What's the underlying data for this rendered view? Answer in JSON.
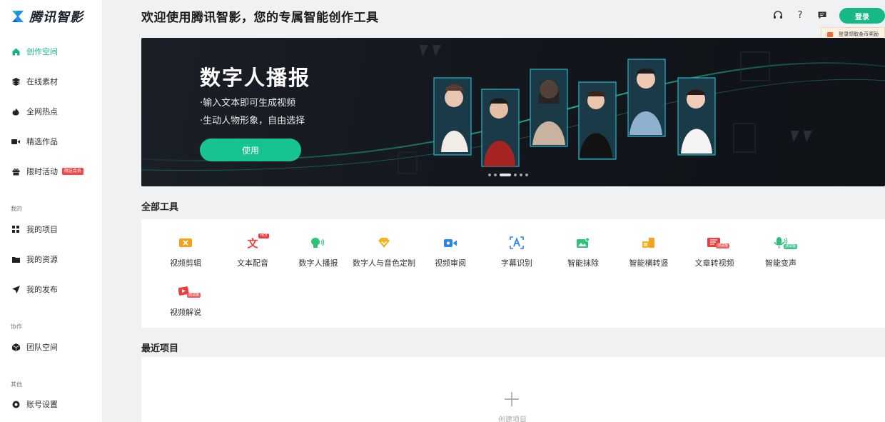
{
  "app": {
    "logo_text": "腾讯智影"
  },
  "sidebar": {
    "items": [
      {
        "label": "创作空间",
        "icon": "home-icon",
        "active": true
      },
      {
        "label": "在线素材",
        "icon": "layers-icon"
      },
      {
        "label": "全网热点",
        "icon": "fire-icon"
      },
      {
        "label": "精选作品",
        "icon": "video-icon"
      },
      {
        "label": "限时活动",
        "icon": "gift-icon",
        "badge": "限送会员"
      }
    ],
    "section_mine": "我的",
    "mine_items": [
      {
        "label": "我的项目",
        "icon": "grid-icon"
      },
      {
        "label": "我的资源",
        "icon": "folder-icon"
      },
      {
        "label": "我的发布",
        "icon": "send-icon"
      }
    ],
    "section_collab": "协作",
    "collab_items": [
      {
        "label": "团队空间",
        "icon": "cube-icon"
      }
    ],
    "section_other": "其他",
    "other_items": [
      {
        "label": "账号设置",
        "icon": "settings-icon"
      }
    ]
  },
  "header": {
    "title": "欢迎使用腾讯智影，您的专属智能创作工具",
    "login_label": "登录",
    "login_tip": "登录领取金币奖励"
  },
  "banner": {
    "title": "数字人播报",
    "line1": "·输入文本即可生成视频",
    "line2": "·生动人物形象，自由选择",
    "button": "使用",
    "slides": 6,
    "active_slide": 3
  },
  "tools": {
    "section_title": "全部工具",
    "items": [
      {
        "label": "视频剪辑",
        "icon": "video-edit-icon"
      },
      {
        "label": "文本配音",
        "icon": "text-voice-icon",
        "tag": "HOT"
      },
      {
        "label": "数字人播报",
        "icon": "digital-human-icon"
      },
      {
        "label": "数字人与音色定制",
        "icon": "custom-voice-icon"
      },
      {
        "label": "视频审阅",
        "icon": "video-review-icon"
      },
      {
        "label": "字幕识别",
        "icon": "subtitle-icon"
      },
      {
        "label": "智能抹除",
        "icon": "erase-icon"
      },
      {
        "label": "智能横转竖",
        "icon": "rotate-icon"
      },
      {
        "label": "文章转视频",
        "icon": "article-video-icon",
        "tag": "测试版"
      },
      {
        "label": "智能变声",
        "icon": "voice-change-icon",
        "tag": "测试版"
      },
      {
        "label": "视频解说",
        "icon": "video-narrate-icon",
        "tag": "测试版"
      }
    ]
  },
  "recent": {
    "section_title": "最近项目",
    "create_label": "创建项目"
  },
  "colors": {
    "accent": "#16b884",
    "hot": "#f04848"
  }
}
